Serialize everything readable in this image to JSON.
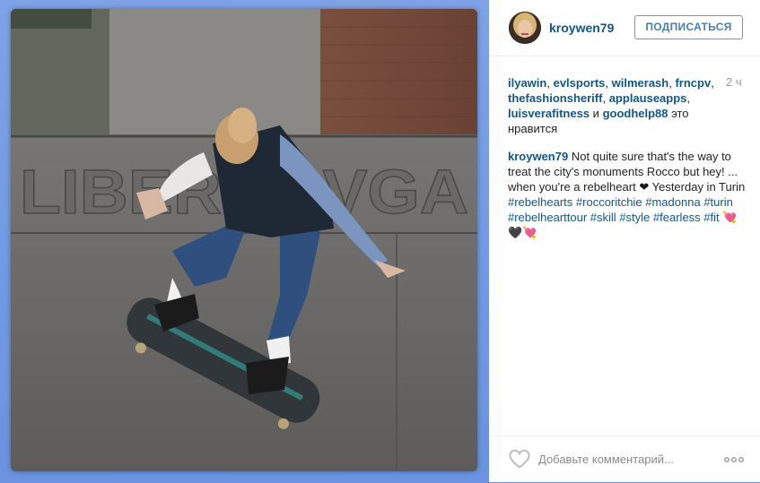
{
  "post": {
    "username": "kroywen79",
    "follow_label": "ПОДПИСАТЬСЯ",
    "timestamp": "2 ч",
    "likes": {
      "names": [
        "ilyawin",
        "evlsports",
        "wilmerash",
        "frncpv",
        "thefashionsheriff",
        "applauseapps",
        "luisverafitness"
      ],
      "and_word": "и",
      "last_name": "goodhelp88",
      "suffix": "это нравится"
    },
    "caption": {
      "author": "kroywen79",
      "text": "Not quite sure that's the way to treat the city's monuments Rocco but hey! ... when you're a rebelheart",
      "heart": "❤",
      "text_after": "Yesterday in Turin",
      "hashtags": [
        "#rebelhearts",
        "#roccoritchie",
        "#madonna",
        "#turin",
        "#rebelhearttour",
        "#skill",
        "#style",
        "#fearless",
        "#fit"
      ],
      "emoji": "💘🖤💘"
    },
    "photo": {
      "engraved_text": "LIBERTA VGA"
    },
    "comment_placeholder": "Добавьте комментарий..."
  },
  "colors": {
    "background": "#6d94de",
    "link": "#125688",
    "button_border": "#6f97b6"
  },
  "icons": [
    "heart-outline-icon",
    "more-options-icon"
  ]
}
